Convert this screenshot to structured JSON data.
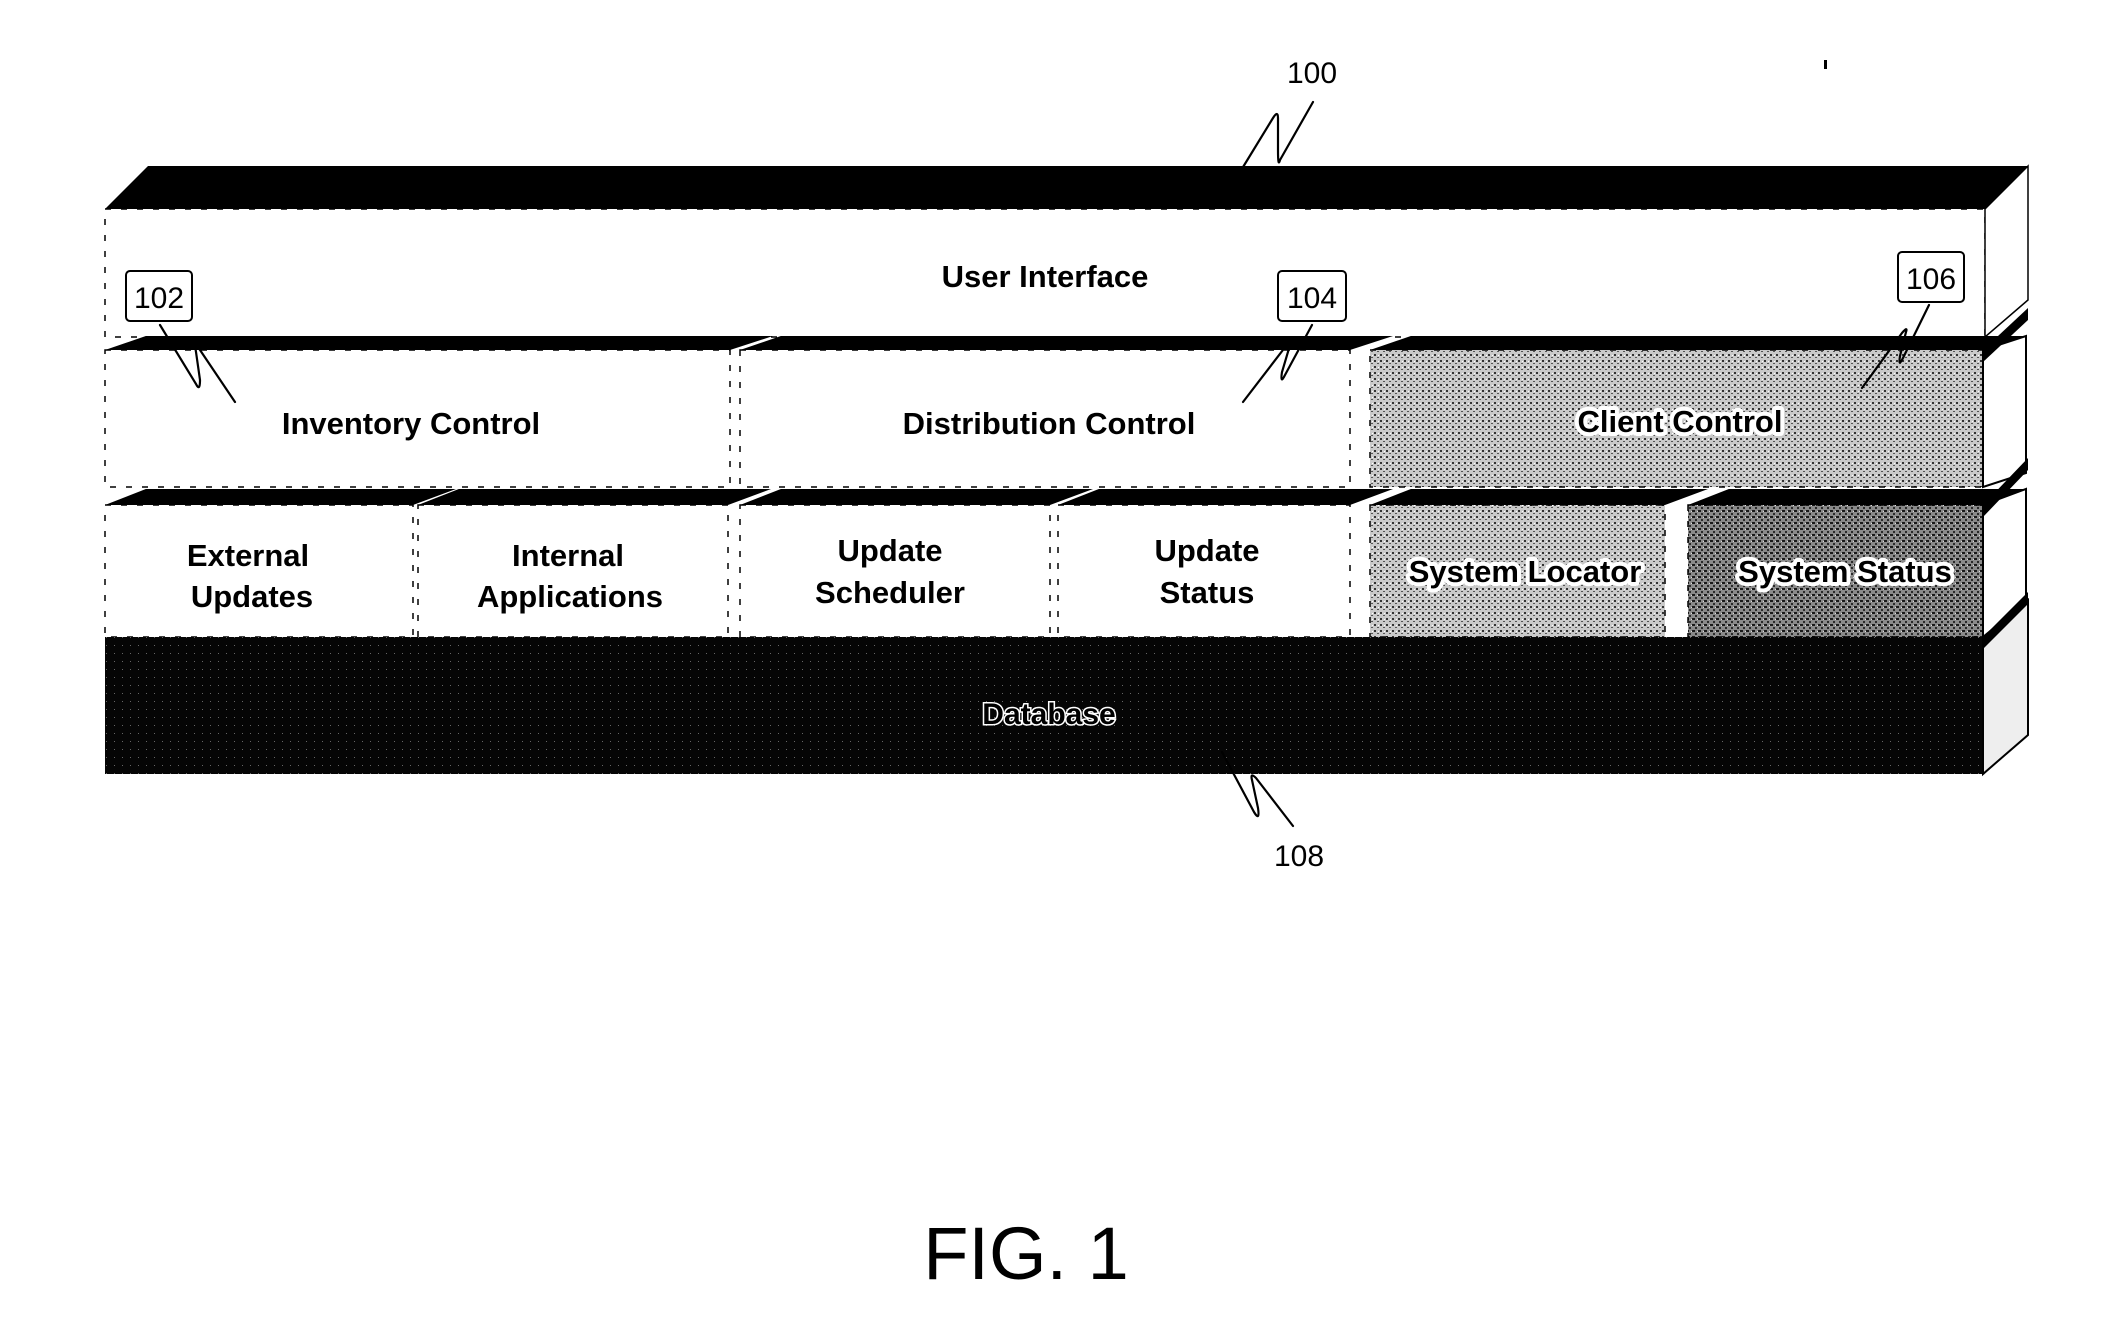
{
  "figure": {
    "caption": "FIG. 1",
    "reference_numerals": {
      "system": "100",
      "inventory_control": "102",
      "distribution_control": "104",
      "client_control": "106",
      "database": "108"
    },
    "layers": {
      "user_interface": {
        "label": "User Interface",
        "shade": "white"
      },
      "control_row": [
        {
          "id": "inventory-control",
          "label": "Inventory Control",
          "shade": "white"
        },
        {
          "id": "distribution-control",
          "label": "Distribution Control",
          "shade": "white"
        },
        {
          "id": "client-control",
          "label": "Client Control",
          "shade": "light-stipple"
        }
      ],
      "module_row": [
        {
          "id": "external-updates",
          "lines": [
            "External",
            "Updates"
          ],
          "shade": "white"
        },
        {
          "id": "internal-applications",
          "lines": [
            "Internal",
            "Applications"
          ],
          "shade": "white"
        },
        {
          "id": "update-scheduler",
          "lines": [
            "Update",
            "Scheduler"
          ],
          "shade": "white"
        },
        {
          "id": "update-status",
          "lines": [
            "Update",
            "Status"
          ],
          "shade": "white"
        },
        {
          "id": "system-locator",
          "lines": [
            "System Locator"
          ],
          "shade": "light-stipple"
        },
        {
          "id": "system-status",
          "lines": [
            "System Status"
          ],
          "shade": "dark-stipple"
        }
      ],
      "database": {
        "label": "Database",
        "shade": "black"
      }
    },
    "colors": {
      "ink": "#000000",
      "paper": "#ffffff",
      "light_stipple": "#a8a8a8",
      "dark_stipple": "#6e6e6e"
    }
  }
}
